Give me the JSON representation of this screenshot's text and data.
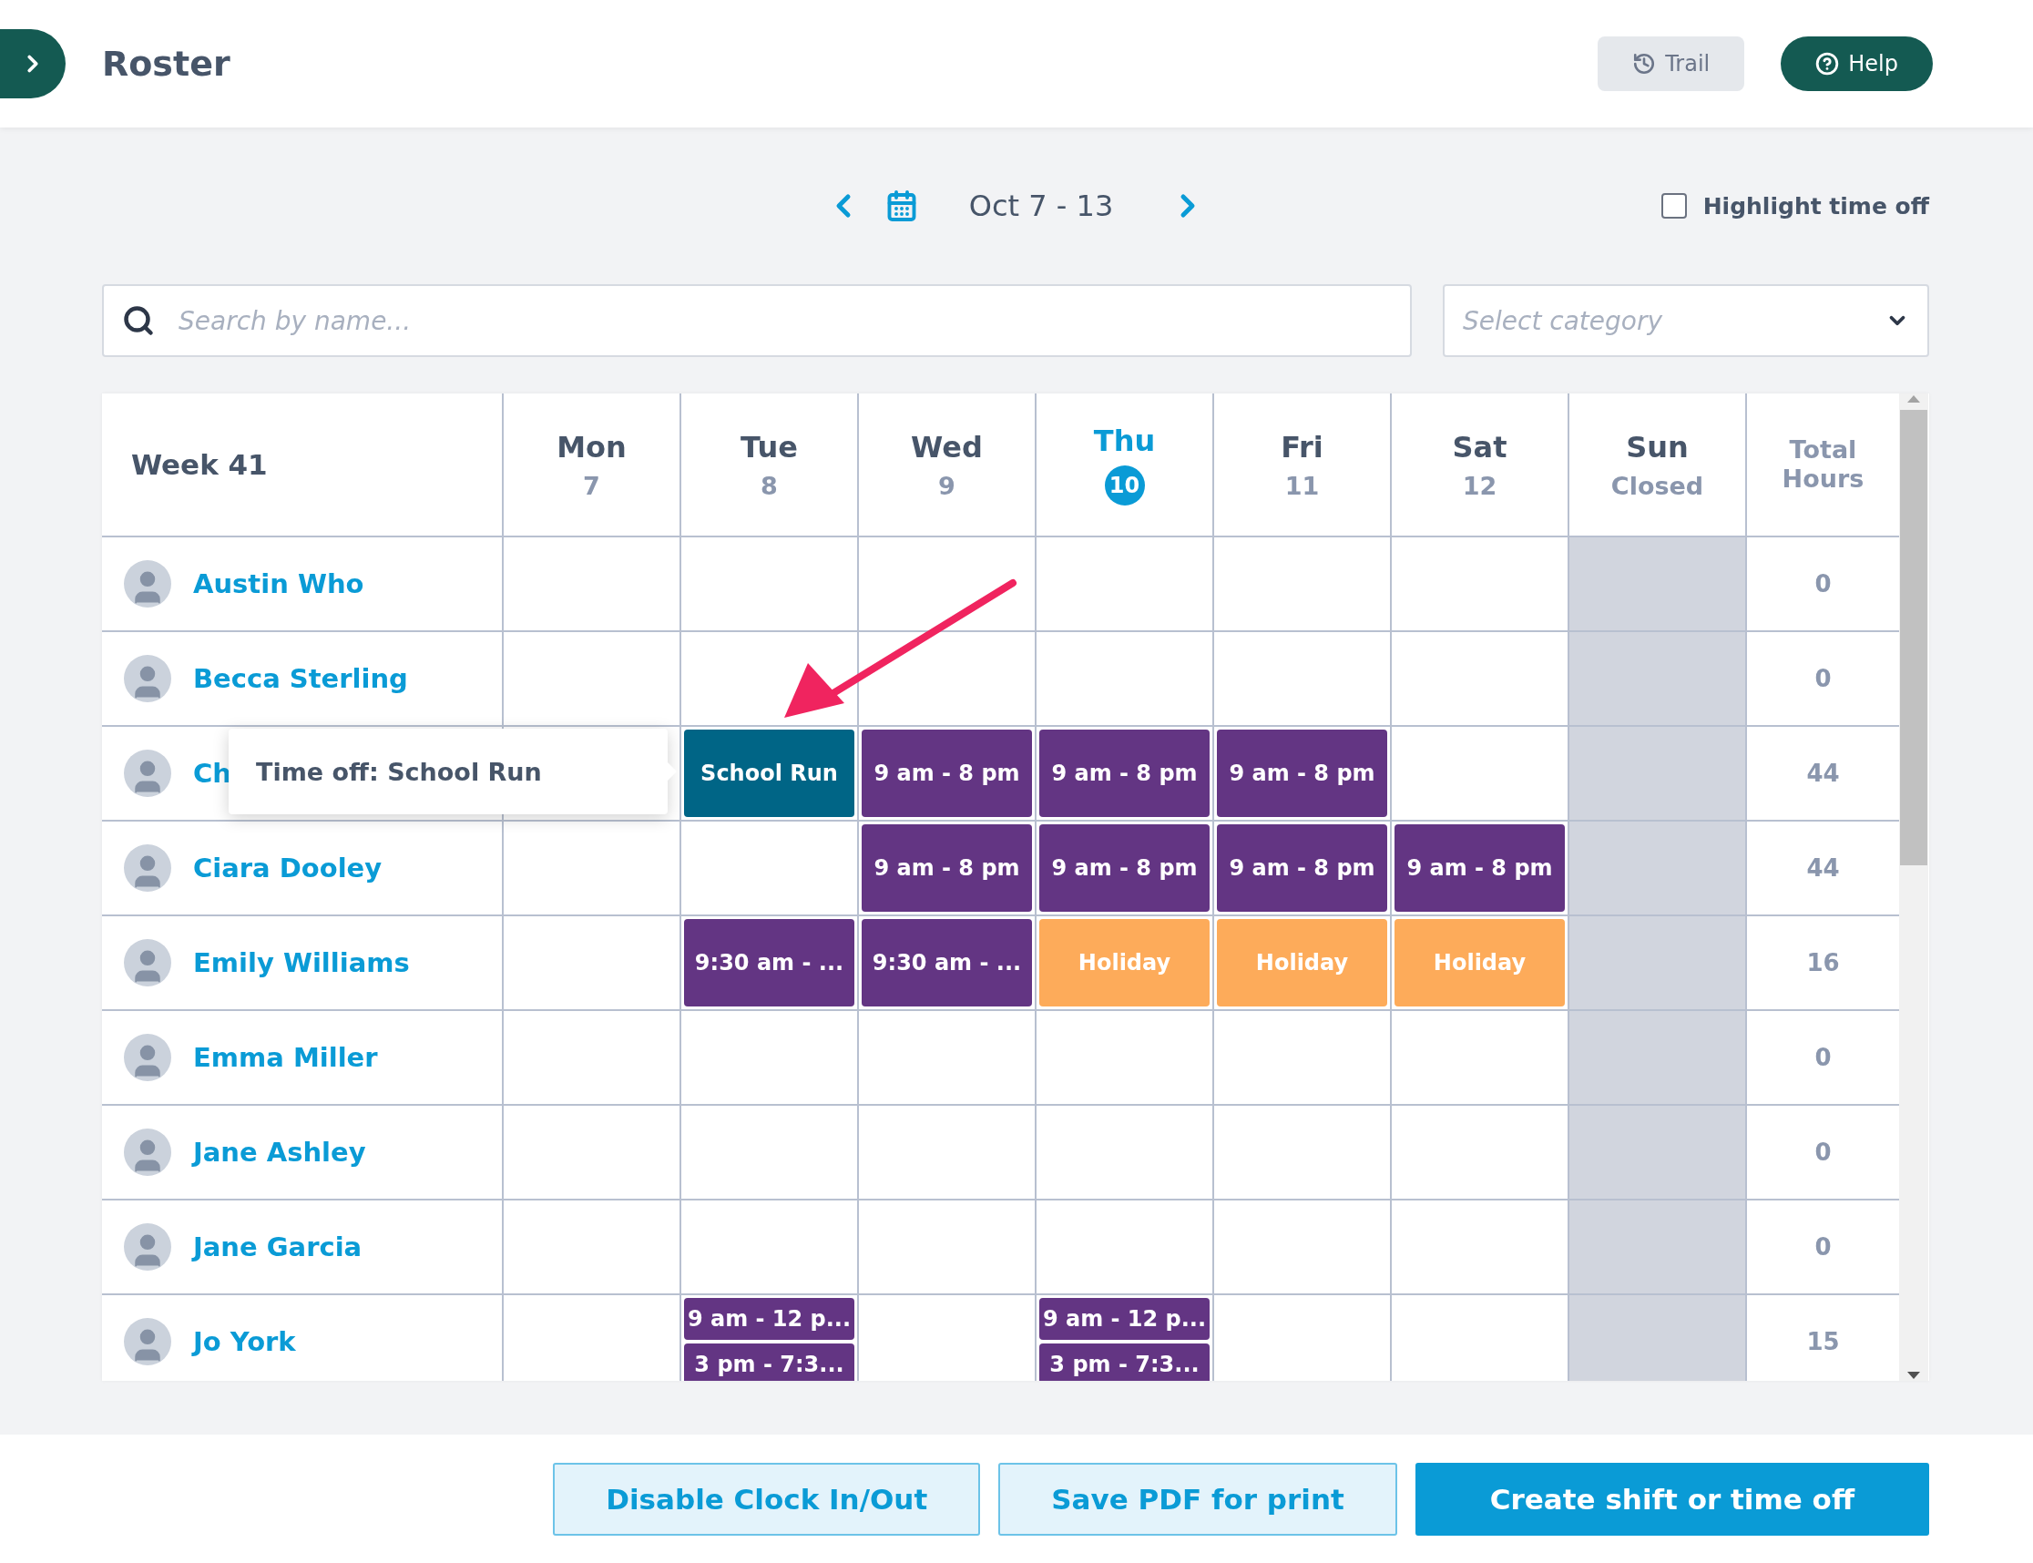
{
  "header": {
    "title": "Roster",
    "buttons": [
      {
        "label": "Trail",
        "kind": "secondary"
      },
      {
        "label": "Help",
        "kind": "primary"
      }
    ]
  },
  "week_nav": {
    "range": "Oct 7 - 13",
    "highlight_time_off": {
      "label": "Highlight time off",
      "checked": false
    }
  },
  "filters": {
    "search": {
      "placeholder": "Search by name..."
    },
    "category": {
      "placeholder": "Select category"
    }
  },
  "roster": {
    "week_label": "Week 41",
    "total_label": "Total Hours",
    "days": [
      {
        "name": "Mon",
        "sub": "7",
        "selected": false,
        "closed": false
      },
      {
        "name": "Tue",
        "sub": "8",
        "selected": false,
        "closed": false
      },
      {
        "name": "Wed",
        "sub": "9",
        "selected": false,
        "closed": false
      },
      {
        "name": "Thu",
        "sub": "10",
        "selected": true,
        "closed": false
      },
      {
        "name": "Fri",
        "sub": "11",
        "selected": false,
        "closed": false
      },
      {
        "name": "Sat",
        "sub": "12",
        "selected": false,
        "closed": false
      },
      {
        "name": "Sun",
        "sub": "Closed",
        "selected": false,
        "closed": true
      }
    ],
    "rows": [
      {
        "name": "Austin Who",
        "cells": [
          null,
          null,
          null,
          null,
          null,
          null,
          null
        ],
        "total": "0"
      },
      {
        "name": "Becca Sterling",
        "cells": [
          null,
          null,
          null,
          null,
          null,
          null,
          null
        ],
        "total": "0"
      },
      {
        "name": "Ch",
        "tooltip": "Time off: School Run",
        "cells": [
          null,
          [
            {
              "text": "School Run",
              "kind": "timeoff"
            }
          ],
          [
            {
              "text": "9 am - 8 pm",
              "kind": "shift"
            }
          ],
          [
            {
              "text": "9 am - 8 pm",
              "kind": "shift"
            }
          ],
          [
            {
              "text": "9 am - 8 pm",
              "kind": "shift"
            }
          ],
          null,
          null
        ],
        "total": "44"
      },
      {
        "name": "Ciara Dooley",
        "cells": [
          null,
          null,
          [
            {
              "text": "9 am - 8 pm",
              "kind": "shift"
            }
          ],
          [
            {
              "text": "9 am - 8 pm",
              "kind": "shift"
            }
          ],
          [
            {
              "text": "9 am - 8 pm",
              "kind": "shift"
            }
          ],
          [
            {
              "text": "9 am - 8 pm",
              "kind": "shift"
            }
          ],
          null
        ],
        "total": "44"
      },
      {
        "name": "Emily Williams",
        "cells": [
          null,
          [
            {
              "text": "9:30 am - ...",
              "kind": "shift"
            }
          ],
          [
            {
              "text": "9:30 am - ...",
              "kind": "shift"
            }
          ],
          [
            {
              "text": "Holiday",
              "kind": "holiday"
            }
          ],
          [
            {
              "text": "Holiday",
              "kind": "holiday"
            }
          ],
          [
            {
              "text": "Holiday",
              "kind": "holiday"
            }
          ],
          null
        ],
        "total": "16"
      },
      {
        "name": "Emma Miller",
        "cells": [
          null,
          null,
          null,
          null,
          null,
          null,
          null
        ],
        "total": "0"
      },
      {
        "name": "Jane Ashley",
        "cells": [
          null,
          null,
          null,
          null,
          null,
          null,
          null
        ],
        "total": "0"
      },
      {
        "name": "Jane Garcia",
        "cells": [
          null,
          null,
          null,
          null,
          null,
          null,
          null
        ],
        "total": "0"
      },
      {
        "name": "Jo York",
        "cells": [
          null,
          [
            {
              "text": "9 am - 12 p...",
              "kind": "shift"
            },
            {
              "text": "3 pm - 7:3...",
              "kind": "shift"
            }
          ],
          null,
          [
            {
              "text": "9 am - 12 p...",
              "kind": "shift"
            },
            {
              "text": "3 pm - 7:3...",
              "kind": "shift"
            }
          ],
          null,
          null,
          null
        ],
        "total": "15"
      }
    ]
  },
  "footer": {
    "buttons": [
      {
        "label": "Disable Clock In/Out",
        "kind": "outline"
      },
      {
        "label": "Save PDF for print",
        "kind": "outline"
      },
      {
        "label": "Create shift or time off",
        "kind": "primary"
      }
    ]
  }
}
